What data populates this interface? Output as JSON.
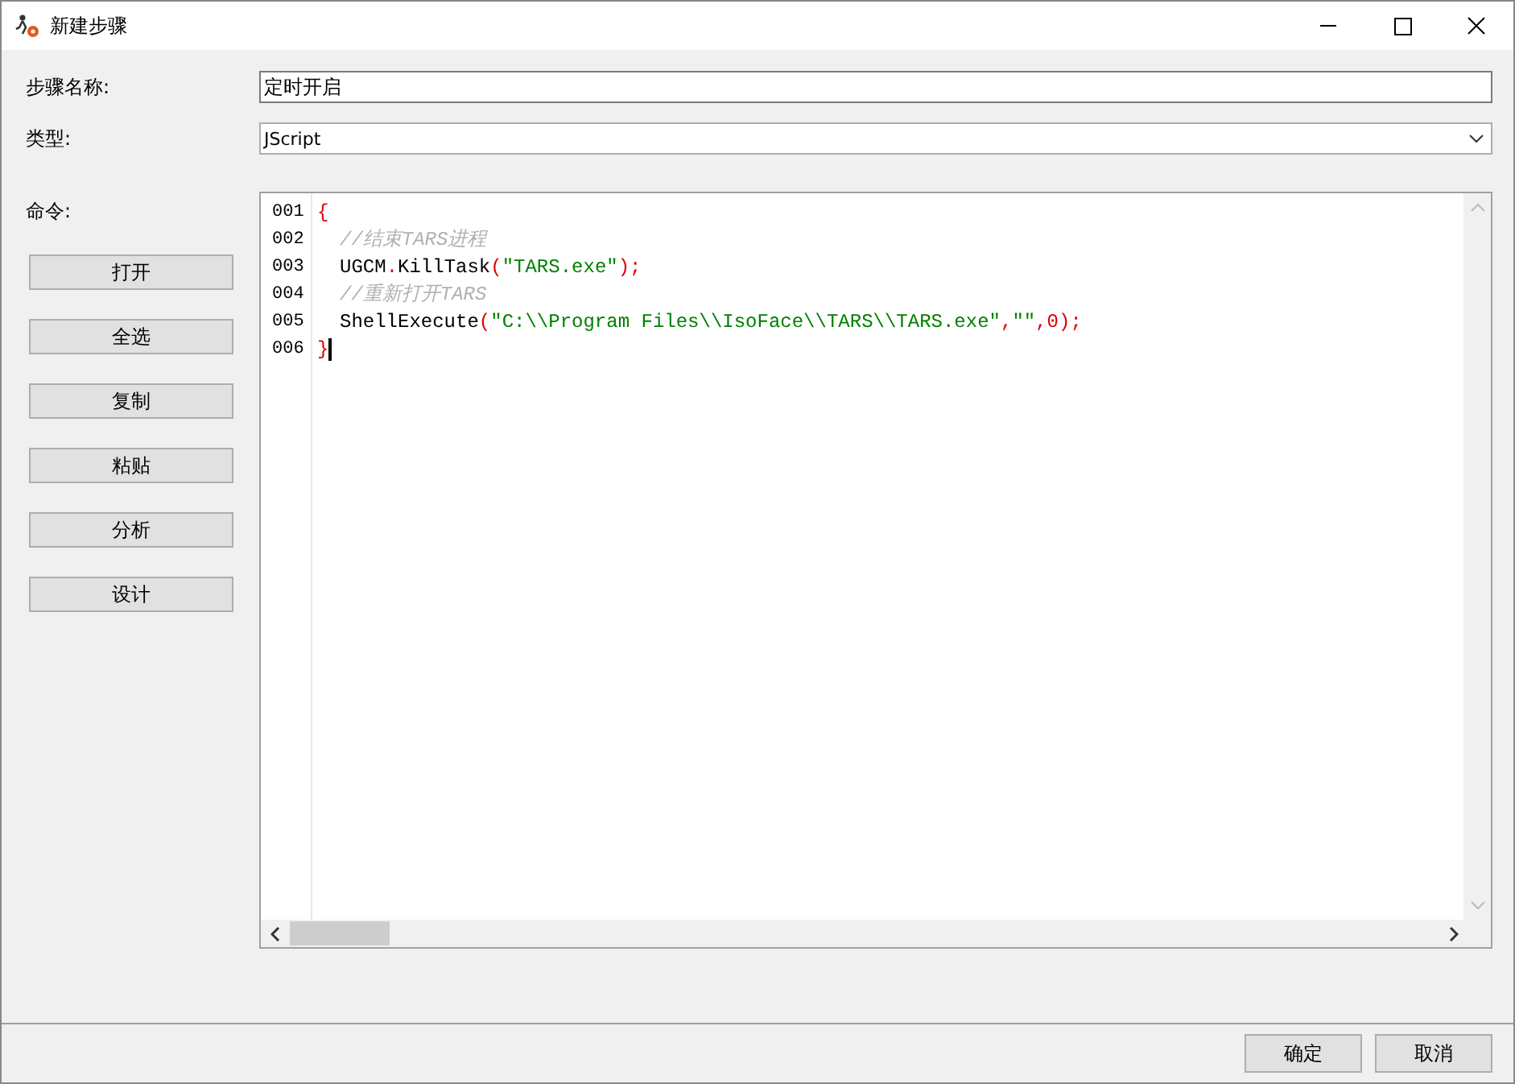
{
  "window": {
    "title": "新建步骤"
  },
  "form": {
    "name_label": "步骤名称:",
    "name_value": "定时开启",
    "type_label": "类型:",
    "type_value": "JScript",
    "command_label": "命令:"
  },
  "side_buttons": [
    "打开",
    "全选",
    "复制",
    "粘贴",
    "分析",
    "设计"
  ],
  "editor": {
    "lines": [
      {
        "number": "001",
        "tokens": [
          {
            "kind": "punct",
            "text": "{"
          }
        ]
      },
      {
        "number": "002",
        "indented": true,
        "tokens": [
          {
            "kind": "comment",
            "text": "//结束TARS进程"
          }
        ]
      },
      {
        "number": "003",
        "indented": true,
        "tokens": [
          {
            "kind": "ident",
            "text": "UGCM"
          },
          {
            "kind": "punct",
            "text": "."
          },
          {
            "kind": "ident",
            "text": "KillTask"
          },
          {
            "kind": "punct",
            "text": "("
          },
          {
            "kind": "string",
            "text": "\"TARS.exe\""
          },
          {
            "kind": "punct",
            "text": ");"
          }
        ]
      },
      {
        "number": "004",
        "indented": true,
        "tokens": [
          {
            "kind": "comment",
            "text": "//重新打开TARS"
          }
        ]
      },
      {
        "number": "005",
        "indented": true,
        "tokens": [
          {
            "kind": "ident",
            "text": "ShellExecute"
          },
          {
            "kind": "punct",
            "text": "("
          },
          {
            "kind": "string",
            "text": "\"C:\\\\Program Files\\\\IsoFace\\\\TARS\\\\TARS.exe\""
          },
          {
            "kind": "punct",
            "text": ","
          },
          {
            "kind": "string",
            "text": "\"\""
          },
          {
            "kind": "punct",
            "text": ","
          },
          {
            "kind": "number",
            "text": "0"
          },
          {
            "kind": "punct",
            "text": ");"
          }
        ]
      },
      {
        "number": "006",
        "tokens": [
          {
            "kind": "punct",
            "text": "}"
          }
        ]
      }
    ]
  },
  "footer_buttons": [
    "确定",
    "取消"
  ]
}
